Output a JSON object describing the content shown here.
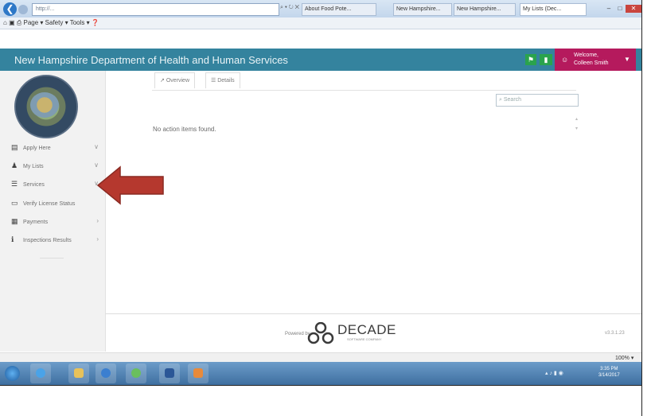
{
  "browser": {
    "url": "http://...",
    "tabs": [
      "About Food Pote...",
      "New Hampshire...",
      "New Hampshire...",
      "My Lists (Dec..."
    ],
    "command_items": [
      "Page",
      "Safety",
      "Tools"
    ],
    "zoom": "100%"
  },
  "header": {
    "title": "New Hampshire Department of Health and Human Services",
    "welcome_line1": "Welcome,",
    "welcome_line2": "Colleen Smith"
  },
  "sidebar": {
    "items": [
      {
        "label": "Apply Here",
        "icon": "document-icon"
      },
      {
        "label": "My Lists",
        "icon": "user-icon"
      },
      {
        "label": "Services",
        "icon": "list-icon"
      },
      {
        "label": "Verify License Status",
        "icon": "card-icon"
      },
      {
        "label": "Payments",
        "icon": "table-icon"
      },
      {
        "label": "Inspections Results",
        "icon": "info-icon"
      }
    ]
  },
  "main": {
    "tabs": [
      {
        "label": "Overview",
        "icon": "chart-icon"
      },
      {
        "label": "Details",
        "icon": "list-icon"
      }
    ],
    "search_placeholder": "Search",
    "empty_message": "No action items found."
  },
  "footer": {
    "powered_by": "Powered by",
    "brand": "DECADE",
    "brand_sub": "SOFTWARE COMPANY",
    "version": "v3.3.1.23"
  },
  "taskbar": {
    "time": "3:35 PM",
    "date": "3/14/2017"
  },
  "colors": {
    "header": "#34839e",
    "welcome": "#b51a5d",
    "highlight_arrow": "#b5382e"
  }
}
